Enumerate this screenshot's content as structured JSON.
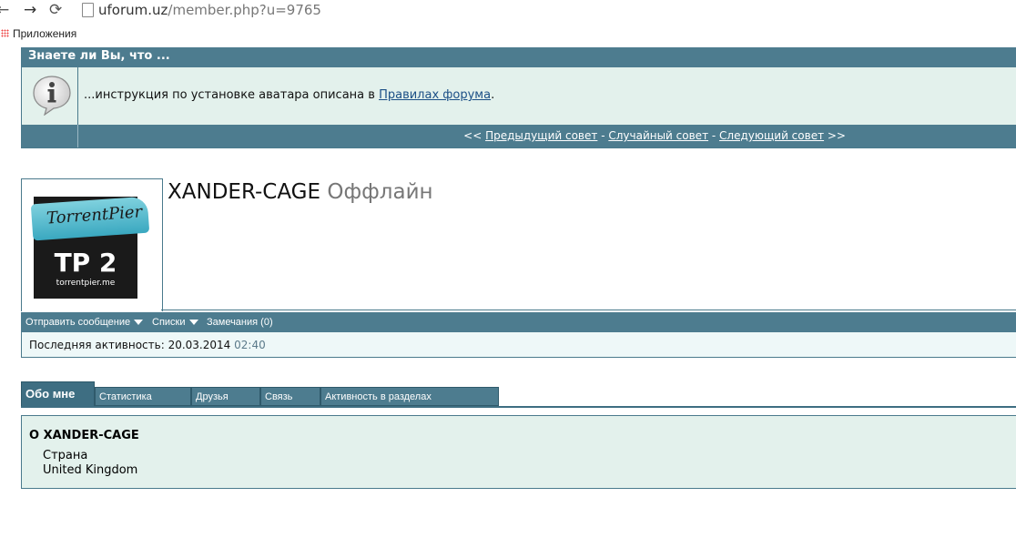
{
  "browser": {
    "back": "←",
    "forward": "→",
    "reload": "⟳",
    "url_host": "uforum.uz",
    "url_path": "/member.php?u=9765",
    "bookmarks_label": "Приложения"
  },
  "tip": {
    "header": "Знаете ли Вы, что ...",
    "text_before": "...инструкция по установке аватара описана в ",
    "link": "Правилах форума",
    "text_after": ".",
    "nav_prefix": "<< ",
    "prev": "Предыдущий совет",
    "sep1": " - ",
    "random": "Случайный совет",
    "sep2": " - ",
    "next": "Следующий совет",
    "nav_suffix": " >>"
  },
  "avatar": {
    "logo_text": "TorrentPier",
    "big_text": "TP 2",
    "site": "torrentpier.me"
  },
  "profile": {
    "username": "XANDER-CAGE",
    "status": "Оффлайн"
  },
  "actions": {
    "send_message": "Отправить сообщение",
    "lists": "Списки",
    "notes": "Замечания (0)"
  },
  "activity": {
    "label": "Последняя активность: ",
    "date": "20.03.2014",
    "time": "02:40"
  },
  "tabs": [
    {
      "label": "Обо мне",
      "active": true
    },
    {
      "label": "Статистика",
      "active": false
    },
    {
      "label": "Друзья",
      "active": false
    },
    {
      "label": "Связь",
      "active": false
    },
    {
      "label": "Активность в разделах",
      "active": false
    }
  ],
  "about": {
    "title": "О XANDER-CAGE",
    "country_label": "Страна",
    "country_value": "United Kingdom"
  },
  "colors": {
    "bar": "#4d7c8f",
    "panel": "#e3f1ec",
    "link": "#1b4f86"
  }
}
